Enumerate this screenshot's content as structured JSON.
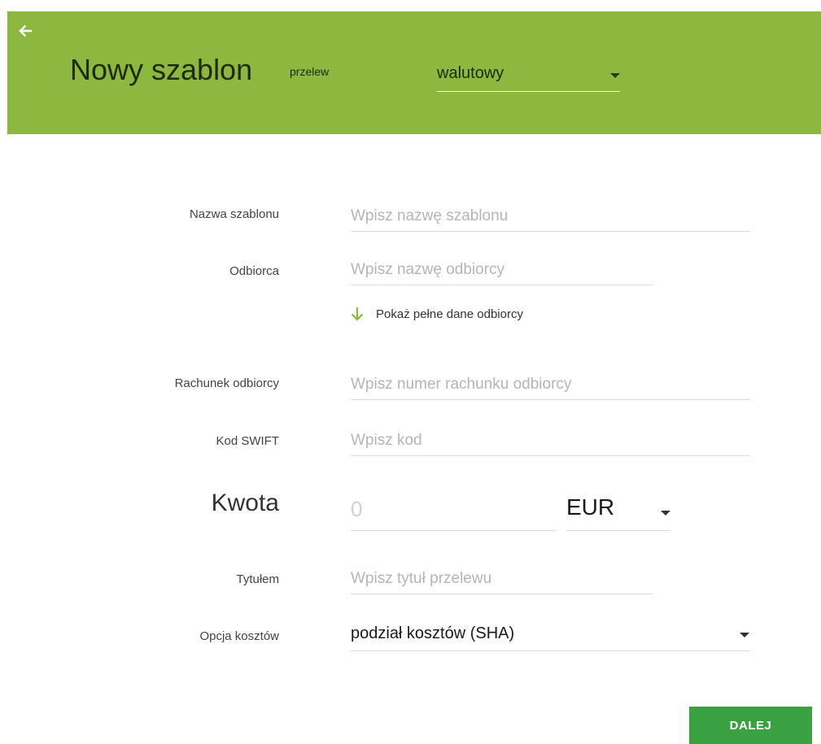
{
  "header": {
    "title": "Nowy szablon",
    "subtitle": "przelew",
    "transfer_type": "walutowy"
  },
  "form": {
    "template_name": {
      "label": "Nazwa szablonu",
      "placeholder": "Wpisz nazwę szablonu",
      "value": ""
    },
    "recipient": {
      "label": "Odbiorca",
      "placeholder": "Wpisz nazwę odbiorcy",
      "value": ""
    },
    "show_full_recipient_label": "Pokaż pełne dane odbiorcy",
    "recipient_account": {
      "label": "Rachunek odbiorcy",
      "placeholder": "Wpisz numer rachunku odbiorcy",
      "value": ""
    },
    "swift": {
      "label": "Kod SWIFT",
      "placeholder": "Wpisz kod",
      "value": ""
    },
    "amount": {
      "label": "Kwota",
      "placeholder": "0",
      "value": "",
      "currency": "EUR"
    },
    "title": {
      "label": "Tytułem",
      "placeholder": "Wpisz tytuł przelewu",
      "value": ""
    },
    "cost_option": {
      "label": "Opcja kosztów",
      "selected": "podział kosztów (SHA)"
    }
  },
  "actions": {
    "next_label": "DALEJ"
  },
  "colors": {
    "header_bg": "#8cb83f",
    "button_bg": "#3aa142",
    "arrow_green": "#8cb83f"
  },
  "icons": {
    "back": "arrow-left-icon",
    "show_more": "arrow-down-icon",
    "dropdown": "caret-down-icon"
  }
}
